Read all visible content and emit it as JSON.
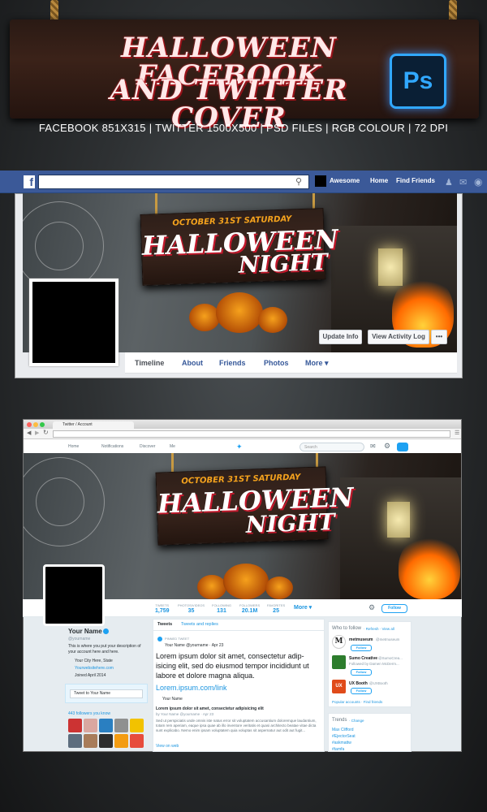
{
  "hero": {
    "title_line1": "HALLOWEEN FACEBOOK",
    "title_line2": "AND TWITTER COVER",
    "ps_logo": "Ps",
    "specs": "FACEBOOK 851X315  |  TWITTER 1500X500  |  PSD FILES  |  RGB COLOUR  |  72 DPI"
  },
  "cover_art": {
    "line1": "OCTOBER 31ST SATURDAY",
    "line2": "HALLOWEEN",
    "line3": "NIGHT"
  },
  "facebook": {
    "logo": "f",
    "search_icon": "search-icon",
    "user": "Awesome",
    "nav": [
      "Home",
      "Find Friends"
    ],
    "buttons": {
      "update": "Update Info",
      "activity": "View Activity Log",
      "more": "•••"
    },
    "tabs": [
      "Timeline",
      "About",
      "Friends",
      "Photos",
      "More ▾"
    ]
  },
  "browser": {
    "tab_title": "Twitter / Account",
    "url": ""
  },
  "twitter": {
    "nav": [
      "Home",
      "Notifications",
      "Discover",
      "Me"
    ],
    "search_placeholder": "Search",
    "stats": [
      {
        "label": "TWEETS",
        "value": "1,759"
      },
      {
        "label": "PHOTOS/VIDEOS",
        "value": "35"
      },
      {
        "label": "FOLLOWING",
        "value": "131"
      },
      {
        "label": "FOLLOWERS",
        "value": "20.1M"
      },
      {
        "label": "FAVORITES",
        "value": "25"
      },
      {
        "label": "",
        "value": "More ▾"
      }
    ],
    "follow_label": "Follow",
    "profile": {
      "name": "Your Name",
      "handle": "@yourname",
      "bio": "This is where you put your description of your account here and here.",
      "location": "Your City Here, State",
      "website": "Yourwebsitehere.com",
      "joined": "Joined April 2014",
      "tweet_to": "Tweet to Your Name",
      "followers_you_know": "443 followers you know"
    },
    "timeline_tabs": [
      "Tweets",
      "Tweets and replies"
    ],
    "pinned": "PINNED TWEET",
    "tweet_author": "Your Name @yourname · Apr 23",
    "tweet_text": "Lorem ipsum dolor sit amet, consectetur adip-isicing elit, sed do eiusmod tempor incididunt ut labore et dolore magna aliqua.",
    "tweet_link": "Lorem.ipsum.com/link",
    "card_name": "Your Name",
    "card_title": "Lorem ipsum dolor sit amet, consectetur adipisicing elit",
    "card_by": "by Your Name @yourname · Apr 23",
    "card_text": "Sed ut perspiciatis unde omnis iste natus error sit voluptatem accusantium doloremque laudantium, totam rem aperiam, eaque ipsa quae ab illo inventore veritatis et quasi architecto beatae vitae dicta sunt explicabo. Nemo enim ipsam voluptatem quia voluptas sit aspernatur aut odit aut fugit...",
    "view_on_web": "View on web",
    "wtf": {
      "title": "Who to follow",
      "refresh": "· Refresh · View all",
      "accounts": [
        {
          "name": "metmuseum",
          "handle": "@metmuseum",
          "note": "",
          "color": "#1c1c1c",
          "initial": "M"
        },
        {
          "name": "Sumo Creative",
          "handle": "@SumoCrea...",
          "note": "Followed by Damen McDerm...",
          "color": "#2d7d2d",
          "initial": ""
        },
        {
          "name": "UX Booth",
          "handle": "@UXBooth",
          "note": "",
          "color": "#e04b1a",
          "initial": "UX"
        }
      ],
      "popular": "Popular accounts · Find friends"
    },
    "trends": {
      "title": "Trends",
      "change": "· Change",
      "items": [
        "Max Clifford",
        "#EjectorSeat",
        "#askmattw",
        "#tamfa"
      ]
    }
  }
}
